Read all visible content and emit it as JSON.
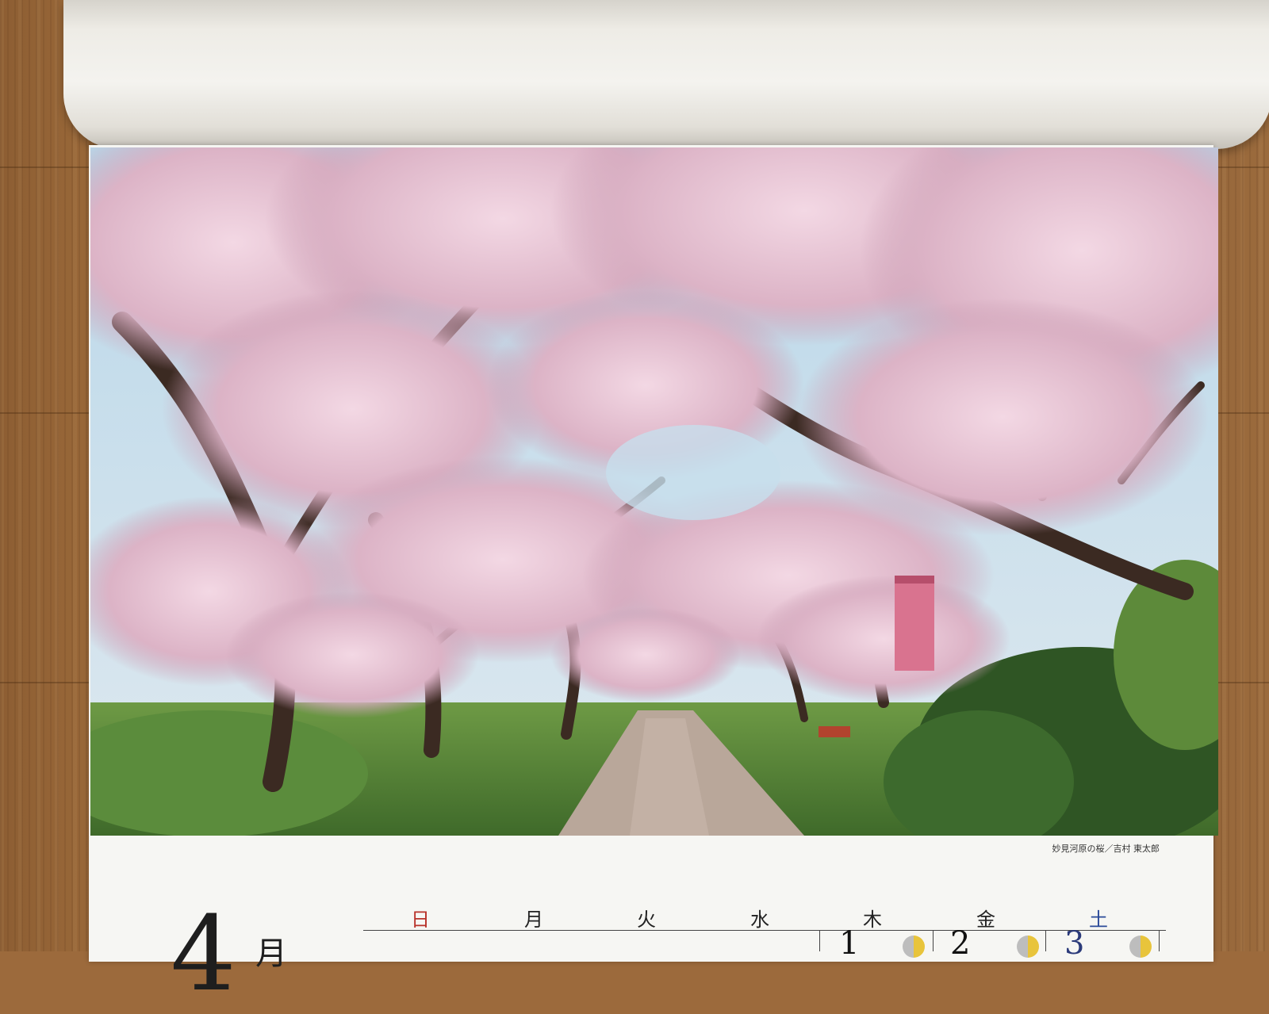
{
  "photo": {
    "subject": "cherry-blossom-avenue-photo"
  },
  "caption": "妙見河原の桜／吉村 東太郎",
  "calendar": {
    "month": "4",
    "month_unit": "月",
    "weekdays": [
      {
        "label": "日",
        "color": "#b8322a"
      },
      {
        "label": "月",
        "color": "#222222"
      },
      {
        "label": "火",
        "color": "#222222"
      },
      {
        "label": "水",
        "color": "#222222"
      },
      {
        "label": "木",
        "color": "#222222"
      },
      {
        "label": "金",
        "color": "#222222"
      },
      {
        "label": "土",
        "color": "#2b4a99"
      }
    ],
    "dates": [
      {
        "day": "1",
        "weekday": "木"
      },
      {
        "day": "2",
        "weekday": "金"
      },
      {
        "day": "3",
        "weekday": "土"
      }
    ]
  }
}
